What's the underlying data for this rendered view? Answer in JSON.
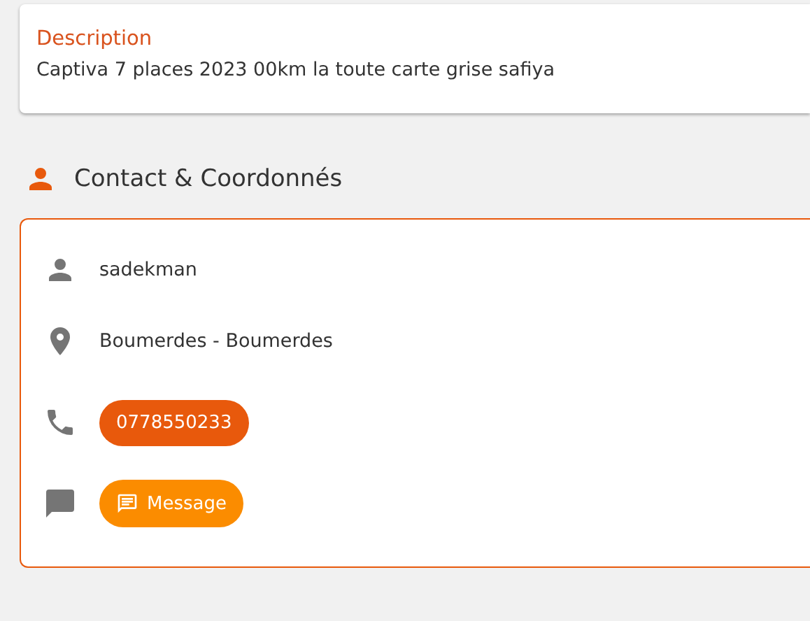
{
  "description": {
    "label": "Description",
    "text": "Captiva 7 places 2023 00km la toute carte grise safiya"
  },
  "contact": {
    "title": "Contact & Coordonnés",
    "rows": [
      {
        "kind": "name",
        "text": "sadekman"
      },
      {
        "kind": "location",
        "text": "Boumerdes - Boumerdes"
      },
      {
        "kind": "phone",
        "text": "0778550233"
      },
      {
        "kind": "message",
        "text": "Message"
      }
    ]
  }
}
